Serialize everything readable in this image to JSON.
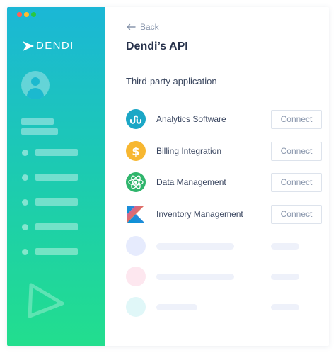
{
  "window": {
    "traffic_lights": [
      "close",
      "minimize",
      "zoom"
    ]
  },
  "sidebar": {
    "logo_text": "DENDI",
    "gradient": {
      "top": "#1bb7d6",
      "bottom": "#22de8e"
    },
    "nav_items": [
      "",
      "",
      "",
      "",
      ""
    ]
  },
  "main": {
    "back_label": "Back",
    "page_title": "Dendi’s API",
    "section_title": "Third-party application",
    "applications": [
      {
        "name": "Analytics Software",
        "icon": "stumbleupon-icon",
        "icon_color": "#1ba7c6",
        "connect_label": "Connect"
      },
      {
        "name": "Billing Integration",
        "icon": "dollar-coin-icon",
        "icon_color": "#f7b731",
        "connect_label": "Connect"
      },
      {
        "name": "Data Management",
        "icon": "atom-icon",
        "icon_color": "#2fb56c",
        "connect_label": "Connect"
      },
      {
        "name": "Inventory Management",
        "icon": "kotlin-icon",
        "icon_color": "#f58a1f",
        "connect_label": "Connect"
      }
    ],
    "placeholder_rows": [
      {
        "circle_color": "#e6ebfd"
      },
      {
        "circle_color": "#fde7ef"
      },
      {
        "circle_color": "#e0f7f8"
      }
    ]
  }
}
